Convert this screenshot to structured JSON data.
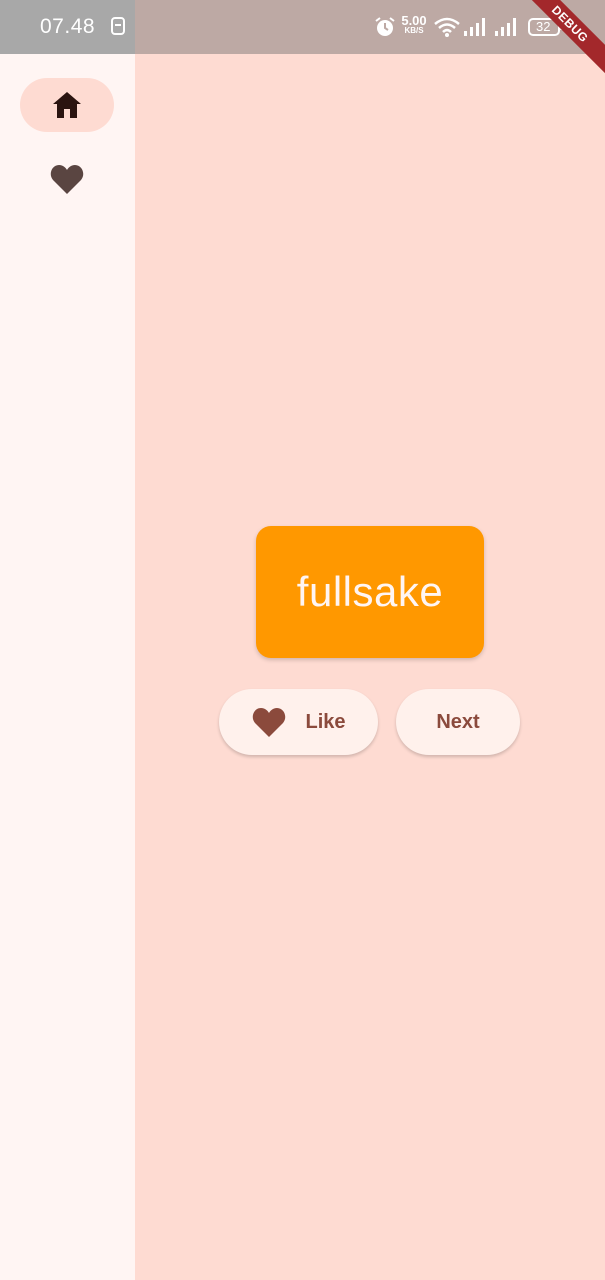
{
  "status_bar": {
    "time": "07.48",
    "net_speed_value": "5.00",
    "net_speed_unit": "KB/S",
    "battery_level": "32",
    "debug_banner": "DEBUG"
  },
  "navigation_rail": {
    "destinations": [
      {
        "icon": "home-icon",
        "selected": true
      },
      {
        "icon": "heart-icon",
        "selected": false
      }
    ]
  },
  "main": {
    "word_pair": "fullsake",
    "like_label": "Like",
    "next_label": "Next"
  },
  "colors": {
    "background": "#fedbd2",
    "rail_background": "#fff5f3",
    "card": "#ff9800",
    "button_text": "#8b4a3c",
    "selected_indicator": "#fedbd2"
  }
}
